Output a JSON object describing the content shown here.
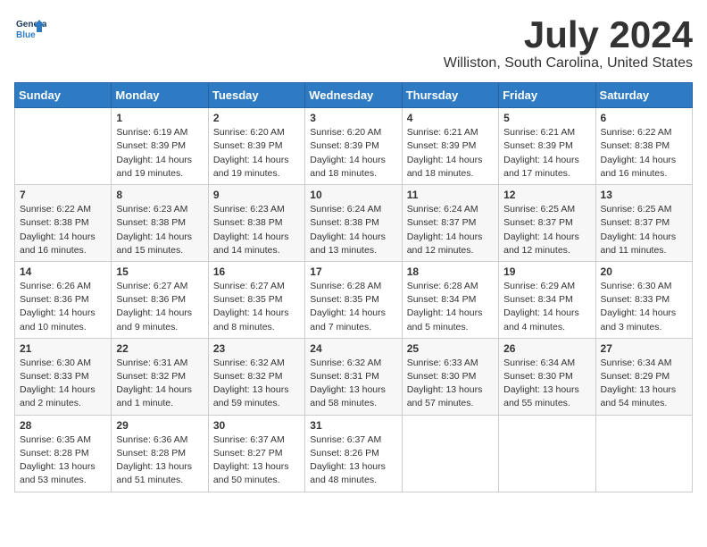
{
  "header": {
    "logo_line1": "General",
    "logo_line2": "Blue",
    "month_title": "July 2024",
    "location": "Williston, South Carolina, United States"
  },
  "weekdays": [
    "Sunday",
    "Monday",
    "Tuesday",
    "Wednesday",
    "Thursday",
    "Friday",
    "Saturday"
  ],
  "weeks": [
    [
      {
        "day": "",
        "info": ""
      },
      {
        "day": "1",
        "info": "Sunrise: 6:19 AM\nSunset: 8:39 PM\nDaylight: 14 hours\nand 19 minutes."
      },
      {
        "day": "2",
        "info": "Sunrise: 6:20 AM\nSunset: 8:39 PM\nDaylight: 14 hours\nand 19 minutes."
      },
      {
        "day": "3",
        "info": "Sunrise: 6:20 AM\nSunset: 8:39 PM\nDaylight: 14 hours\nand 18 minutes."
      },
      {
        "day": "4",
        "info": "Sunrise: 6:21 AM\nSunset: 8:39 PM\nDaylight: 14 hours\nand 18 minutes."
      },
      {
        "day": "5",
        "info": "Sunrise: 6:21 AM\nSunset: 8:39 PM\nDaylight: 14 hours\nand 17 minutes."
      },
      {
        "day": "6",
        "info": "Sunrise: 6:22 AM\nSunset: 8:38 PM\nDaylight: 14 hours\nand 16 minutes."
      }
    ],
    [
      {
        "day": "7",
        "info": "Sunrise: 6:22 AM\nSunset: 8:38 PM\nDaylight: 14 hours\nand 16 minutes."
      },
      {
        "day": "8",
        "info": "Sunrise: 6:23 AM\nSunset: 8:38 PM\nDaylight: 14 hours\nand 15 minutes."
      },
      {
        "day": "9",
        "info": "Sunrise: 6:23 AM\nSunset: 8:38 PM\nDaylight: 14 hours\nand 14 minutes."
      },
      {
        "day": "10",
        "info": "Sunrise: 6:24 AM\nSunset: 8:38 PM\nDaylight: 14 hours\nand 13 minutes."
      },
      {
        "day": "11",
        "info": "Sunrise: 6:24 AM\nSunset: 8:37 PM\nDaylight: 14 hours\nand 12 minutes."
      },
      {
        "day": "12",
        "info": "Sunrise: 6:25 AM\nSunset: 8:37 PM\nDaylight: 14 hours\nand 12 minutes."
      },
      {
        "day": "13",
        "info": "Sunrise: 6:25 AM\nSunset: 8:37 PM\nDaylight: 14 hours\nand 11 minutes."
      }
    ],
    [
      {
        "day": "14",
        "info": "Sunrise: 6:26 AM\nSunset: 8:36 PM\nDaylight: 14 hours\nand 10 minutes."
      },
      {
        "day": "15",
        "info": "Sunrise: 6:27 AM\nSunset: 8:36 PM\nDaylight: 14 hours\nand 9 minutes."
      },
      {
        "day": "16",
        "info": "Sunrise: 6:27 AM\nSunset: 8:35 PM\nDaylight: 14 hours\nand 8 minutes."
      },
      {
        "day": "17",
        "info": "Sunrise: 6:28 AM\nSunset: 8:35 PM\nDaylight: 14 hours\nand 7 minutes."
      },
      {
        "day": "18",
        "info": "Sunrise: 6:28 AM\nSunset: 8:34 PM\nDaylight: 14 hours\nand 5 minutes."
      },
      {
        "day": "19",
        "info": "Sunrise: 6:29 AM\nSunset: 8:34 PM\nDaylight: 14 hours\nand 4 minutes."
      },
      {
        "day": "20",
        "info": "Sunrise: 6:30 AM\nSunset: 8:33 PM\nDaylight: 14 hours\nand 3 minutes."
      }
    ],
    [
      {
        "day": "21",
        "info": "Sunrise: 6:30 AM\nSunset: 8:33 PM\nDaylight: 14 hours\nand 2 minutes."
      },
      {
        "day": "22",
        "info": "Sunrise: 6:31 AM\nSunset: 8:32 PM\nDaylight: 14 hours\nand 1 minute."
      },
      {
        "day": "23",
        "info": "Sunrise: 6:32 AM\nSunset: 8:32 PM\nDaylight: 13 hours\nand 59 minutes."
      },
      {
        "day": "24",
        "info": "Sunrise: 6:32 AM\nSunset: 8:31 PM\nDaylight: 13 hours\nand 58 minutes."
      },
      {
        "day": "25",
        "info": "Sunrise: 6:33 AM\nSunset: 8:30 PM\nDaylight: 13 hours\nand 57 minutes."
      },
      {
        "day": "26",
        "info": "Sunrise: 6:34 AM\nSunset: 8:30 PM\nDaylight: 13 hours\nand 55 minutes."
      },
      {
        "day": "27",
        "info": "Sunrise: 6:34 AM\nSunset: 8:29 PM\nDaylight: 13 hours\nand 54 minutes."
      }
    ],
    [
      {
        "day": "28",
        "info": "Sunrise: 6:35 AM\nSunset: 8:28 PM\nDaylight: 13 hours\nand 53 minutes."
      },
      {
        "day": "29",
        "info": "Sunrise: 6:36 AM\nSunset: 8:28 PM\nDaylight: 13 hours\nand 51 minutes."
      },
      {
        "day": "30",
        "info": "Sunrise: 6:37 AM\nSunset: 8:27 PM\nDaylight: 13 hours\nand 50 minutes."
      },
      {
        "day": "31",
        "info": "Sunrise: 6:37 AM\nSunset: 8:26 PM\nDaylight: 13 hours\nand 48 minutes."
      },
      {
        "day": "",
        "info": ""
      },
      {
        "day": "",
        "info": ""
      },
      {
        "day": "",
        "info": ""
      }
    ]
  ]
}
